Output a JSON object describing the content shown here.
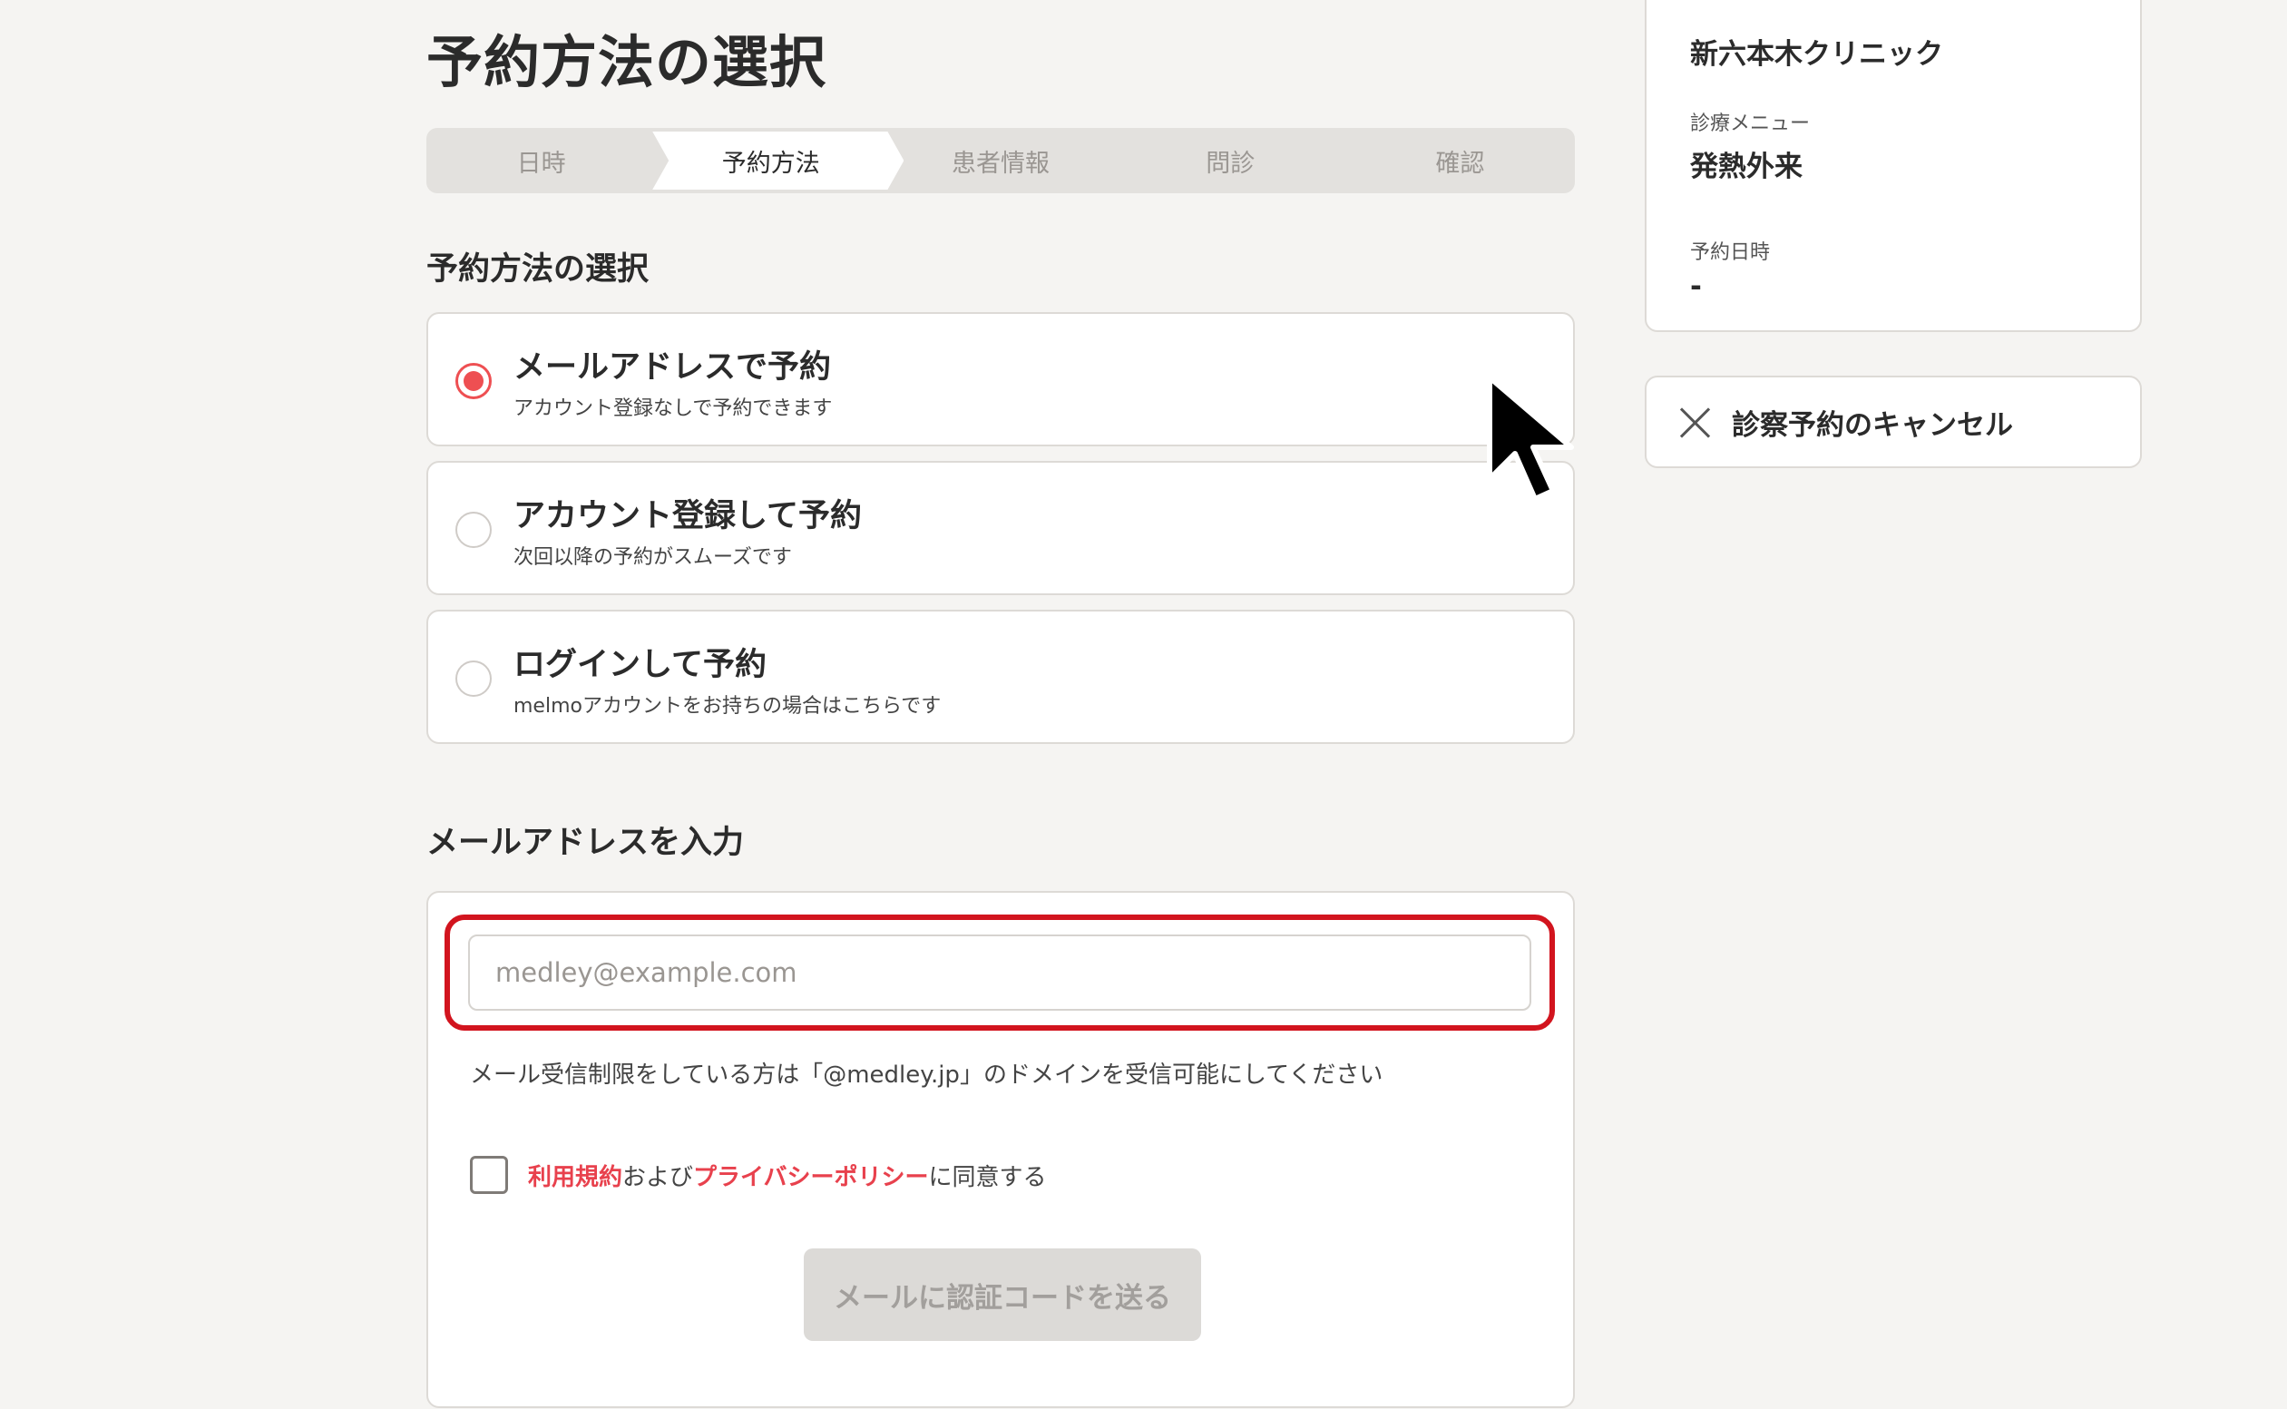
{
  "page": {
    "title": "予約方法の選択"
  },
  "stepper": {
    "steps": [
      {
        "label": "日時"
      },
      {
        "label": "予約方法"
      },
      {
        "label": "患者情報"
      },
      {
        "label": "問診"
      },
      {
        "label": "確認"
      }
    ],
    "active_index": 1
  },
  "method_section": {
    "title": "予約方法の選択"
  },
  "options": [
    {
      "title": "メールアドレスで予約",
      "subtitle": "アカウント登録なしで予約できます",
      "selected": true
    },
    {
      "title": "アカウント登録して予約",
      "subtitle": "次回以降の予約がスムーズです",
      "selected": false
    },
    {
      "title": "ログインして予約",
      "subtitle": "melmoアカウントをお持ちの場合はこちらです",
      "selected": false
    }
  ],
  "email_section": {
    "title": "メールアドレスを入力",
    "input_value": "",
    "input_placeholder": "medley@example.com",
    "note": "メール受信制限をしている方は「@medley.jp」のドメインを受信可能にしてください",
    "agree": {
      "terms_link": "利用規約",
      "and_text": "および",
      "privacy_link": "プライバシーポリシー",
      "suffix": "に同意する",
      "checked": false
    },
    "send_button": "メールに認証コードを送る"
  },
  "summary": {
    "clinic": "新六本木クリニック",
    "menu_label": "診療メニュー",
    "menu_value": "発熱外来",
    "datetime_label": "予約日時",
    "datetime_value": "-"
  },
  "cancel": {
    "label": "診察予約のキャンセル"
  },
  "colors": {
    "accent": "#ee4f52",
    "link": "#e8414d",
    "highlight": "#d2141e",
    "background": "#f5f4f2"
  }
}
